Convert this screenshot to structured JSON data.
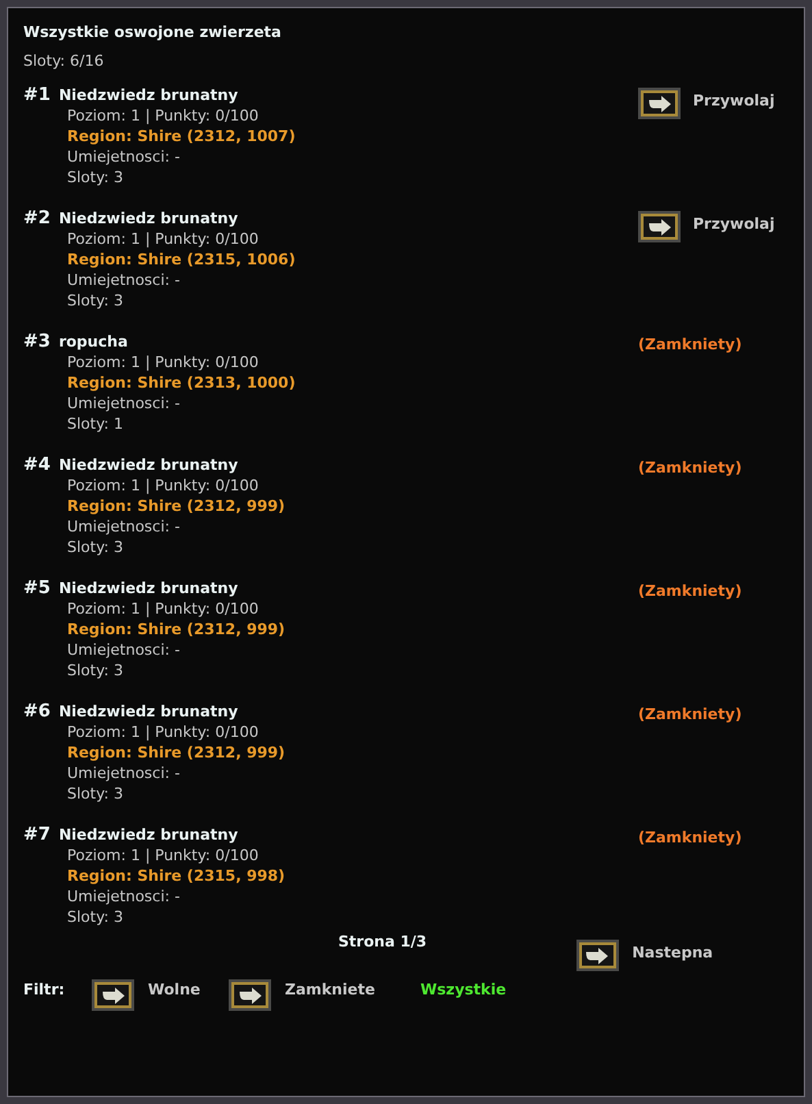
{
  "title": "Wszystkie oswojone zwierzeta",
  "slots": "Sloty: 6/16",
  "pets": [
    {
      "number": "#1",
      "name": "Niedzwiedz brunatny",
      "stats": "Poziom: 1 | Punkty: 0/100",
      "region": "Region: Shire (2312, 1007)",
      "skills": "Umiejetnosci: -",
      "pet_slots": "Sloty: 3",
      "action": {
        "kind": "summon",
        "label": "Przywolaj"
      }
    },
    {
      "number": "#2",
      "name": "Niedzwiedz brunatny",
      "stats": "Poziom: 1 | Punkty: 0/100",
      "region": "Region: Shire (2315, 1006)",
      "skills": "Umiejetnosci: -",
      "pet_slots": "Sloty: 3",
      "action": {
        "kind": "summon",
        "label": "Przywolaj"
      }
    },
    {
      "number": "#3",
      "name": "ropucha",
      "stats": "Poziom: 1 | Punkty: 0/100",
      "region": "Region: Shire (2313, 1000)",
      "skills": "Umiejetnosci: -",
      "pet_slots": "Sloty: 1",
      "action": {
        "kind": "locked",
        "label": "(Zamkniety)"
      }
    },
    {
      "number": "#4",
      "name": "Niedzwiedz brunatny",
      "stats": "Poziom: 1 | Punkty: 0/100",
      "region": "Region: Shire (2312, 999)",
      "skills": "Umiejetnosci: -",
      "pet_slots": "Sloty: 3",
      "action": {
        "kind": "locked",
        "label": "(Zamkniety)"
      }
    },
    {
      "number": "#5",
      "name": "Niedzwiedz brunatny",
      "stats": "Poziom: 1 | Punkty: 0/100",
      "region": "Region: Shire (2312, 999)",
      "skills": "Umiejetnosci: -",
      "pet_slots": "Sloty: 3",
      "action": {
        "kind": "locked",
        "label": "(Zamkniety)"
      }
    },
    {
      "number": "#6",
      "name": "Niedzwiedz brunatny",
      "stats": "Poziom: 1 | Punkty: 0/100",
      "region": "Region: Shire (2312, 999)",
      "skills": "Umiejetnosci: -",
      "pet_slots": "Sloty: 3",
      "action": {
        "kind": "locked",
        "label": "(Zamkniety)"
      }
    },
    {
      "number": "#7",
      "name": "Niedzwiedz brunatny",
      "stats": "Poziom: 1 | Punkty: 0/100",
      "region": "Region: Shire (2315, 998)",
      "skills": "Umiejetnosci: -",
      "pet_slots": "Sloty: 3",
      "action": {
        "kind": "locked",
        "label": "(Zamkniety)"
      }
    }
  ],
  "pagination": {
    "page": "Strona 1/3",
    "next": "Nastepna"
  },
  "filter": {
    "label": "Filtr:",
    "options": [
      {
        "label": "Wolne",
        "selected": false
      },
      {
        "label": "Zamkniete",
        "selected": false
      },
      {
        "label": "Wszystkie",
        "selected": true
      }
    ]
  }
}
